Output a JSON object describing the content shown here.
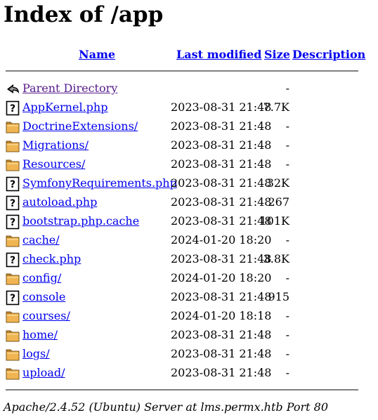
{
  "title": "Index of /app",
  "columns": {
    "name": "Name",
    "last_modified": "Last modified",
    "size": "Size",
    "description": "Description"
  },
  "rows": [
    {
      "name": "Parent Directory",
      "date": "",
      "size": "-",
      "icon": "back-icon"
    },
    {
      "name": "AppKernel.php",
      "date": "2023-08-31 21:48",
      "size": "7.7K",
      "icon": "unknown-file-icon"
    },
    {
      "name": "DoctrineExtensions/",
      "date": "2023-08-31 21:48",
      "size": "-",
      "icon": "folder-icon"
    },
    {
      "name": "Migrations/",
      "date": "2023-08-31 21:48",
      "size": "-",
      "icon": "folder-icon"
    },
    {
      "name": "Resources/",
      "date": "2023-08-31 21:48",
      "size": "-",
      "icon": "folder-icon"
    },
    {
      "name": "SymfonyRequirements.php",
      "date": "2023-08-31 21:48",
      "size": "32K",
      "icon": "unknown-file-icon"
    },
    {
      "name": "autoload.php",
      "date": "2023-08-31 21:48",
      "size": "267",
      "icon": "unknown-file-icon"
    },
    {
      "name": "bootstrap.php.cache",
      "date": "2023-08-31 21:48",
      "size": "101K",
      "icon": "unknown-file-icon"
    },
    {
      "name": "cache/",
      "date": "2024-01-20 18:20",
      "size": "-",
      "icon": "folder-icon"
    },
    {
      "name": "check.php",
      "date": "2023-08-31 21:48",
      "size": "3.8K",
      "icon": "unknown-file-icon"
    },
    {
      "name": "config/",
      "date": "2024-01-20 18:20",
      "size": "-",
      "icon": "folder-icon"
    },
    {
      "name": "console",
      "date": "2023-08-31 21:48",
      "size": "915",
      "icon": "unknown-file-icon"
    },
    {
      "name": "courses/",
      "date": "2024-01-20 18:18",
      "size": "-",
      "icon": "folder-icon"
    },
    {
      "name": "home/",
      "date": "2023-08-31 21:48",
      "size": "-",
      "icon": "folder-icon"
    },
    {
      "name": "logs/",
      "date": "2023-08-31 21:48",
      "size": "-",
      "icon": "folder-icon"
    },
    {
      "name": "upload/",
      "date": "2023-08-31 21:48",
      "size": "-",
      "icon": "folder-icon"
    }
  ],
  "footer": "Apache/2.4.52 (Ubuntu) Server at lms.permx.htb Port 80",
  "colors": {
    "link": "#0000ee",
    "visited": "#551a8b",
    "rule": "#808080"
  }
}
